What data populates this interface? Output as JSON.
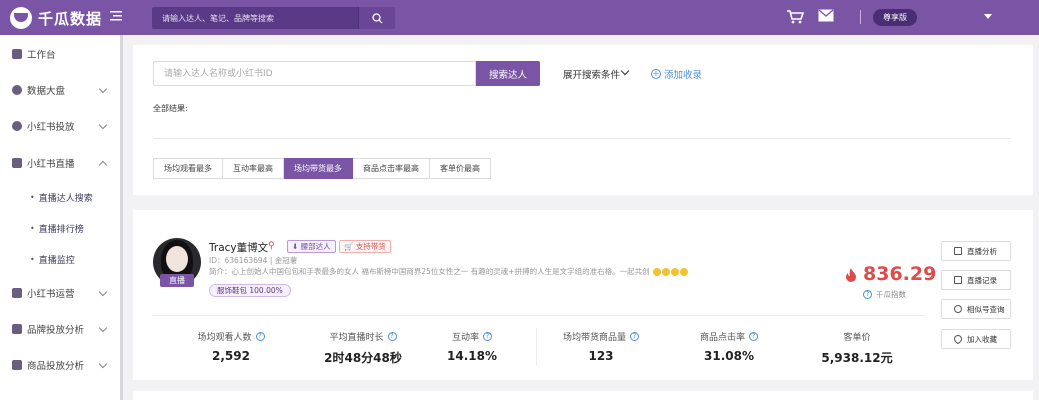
{
  "header": {
    "brand": "千瓜数据",
    "search_placeholder": "请输入达人、笔记、品牌等搜索",
    "edition": "尊享版"
  },
  "sidebar": {
    "items": [
      {
        "label": "工作台"
      },
      {
        "label": "数据大盘"
      },
      {
        "label": "小红书投放"
      },
      {
        "label": "小红书直播"
      },
      {
        "label": "小红书运营"
      },
      {
        "label": "品牌投放分析"
      },
      {
        "label": "商品投放分析"
      }
    ],
    "live_sub_items": [
      {
        "label": "直播达人搜索"
      },
      {
        "label": "直播排行榜"
      },
      {
        "label": "直播监控"
      }
    ]
  },
  "search_panel": {
    "input_placeholder": "请输入达人名称或小红书ID",
    "search_button": "搜索达人",
    "expand_label": "展开搜索条件",
    "add_collect_label": "添加收录",
    "all_results_label": "全部结果:",
    "sort_tabs": [
      {
        "label": "场均观看最多"
      },
      {
        "label": "互动率最高"
      },
      {
        "label": "场均带货最多",
        "active": true
      },
      {
        "label": "商品点击率最高"
      },
      {
        "label": "客单价最高"
      }
    ]
  },
  "result": {
    "name": "Tracy董博文",
    "live_badge": "直播",
    "tag_waist": "腰部达人",
    "tag_cart": "支持带货",
    "id_line": "ID：636163694 | 金冠薯",
    "bio": "简介：心上创始人中国包包和手表最多的女人 福布斯榜中国商界25位女性之一 有趣的灵魂+拼搏的人生是文字组的准右格。一起共创",
    "category": "服饰鞋包 100.00%",
    "index_value": "836.29",
    "index_label": "千瓜指数",
    "stats": [
      {
        "label": "场均观看人数",
        "value": "2,592",
        "help": true
      },
      {
        "label": "平均直播时长",
        "value": "2时48分48秒",
        "help": true
      },
      {
        "label": "互动率",
        "value": "14.18%",
        "help": true
      },
      {
        "label": "场均带货商品量",
        "value": "123",
        "help": true
      },
      {
        "label": "商品点击率",
        "value": "31.08%",
        "help": true
      },
      {
        "label": "客单价",
        "value": "5,938.12元",
        "help": false
      }
    ],
    "actions": [
      {
        "label": "直播分析"
      },
      {
        "label": "直播记录"
      },
      {
        "label": "相似号查询"
      },
      {
        "label": "加入收藏"
      }
    ]
  },
  "colors": {
    "brand_purple": "#7a55a6",
    "index_red": "#e04a4a",
    "link_blue": "#4a90e2"
  }
}
